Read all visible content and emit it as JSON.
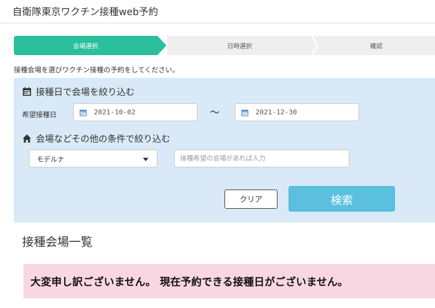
{
  "header": {
    "title": "自衛隊東京ワクチン接種web予約"
  },
  "steps": [
    {
      "label": "会場選択",
      "active": true
    },
    {
      "label": "日時選択",
      "active": false
    },
    {
      "label": "確認",
      "active": false
    }
  ],
  "instructions": "接種会場を選びワクチン接種の予約をしてください。",
  "filter": {
    "date_section_title": "接種日で会場を絞り込む",
    "date_label": "希望接種日",
    "date_from": "2021-10-02",
    "date_separator": "〜",
    "date_to": "2021-12-30",
    "other_section_title": "会場などその他の条件で絞り込む",
    "vaccine_selected": "モデルナ",
    "venue_placeholder": "接種希望の会場があれば入力",
    "clear_label": "クリア",
    "search_label": "検索"
  },
  "list": {
    "title": "接種会場一覧",
    "alert_message": "大変申し訳ございません。 現在予約できる接種日がございません。"
  },
  "colors": {
    "active_step": "#2bbf9c",
    "inactive_step": "#efefef",
    "panel_bg": "#d9e9f7",
    "search_button": "#5bc0de",
    "alert_bg": "#f8d7e3"
  },
  "icons": {
    "date_section": "calendar-icon",
    "date_field": "calendar-icon",
    "other_section": "home-icon",
    "select": "caret-down-icon"
  }
}
